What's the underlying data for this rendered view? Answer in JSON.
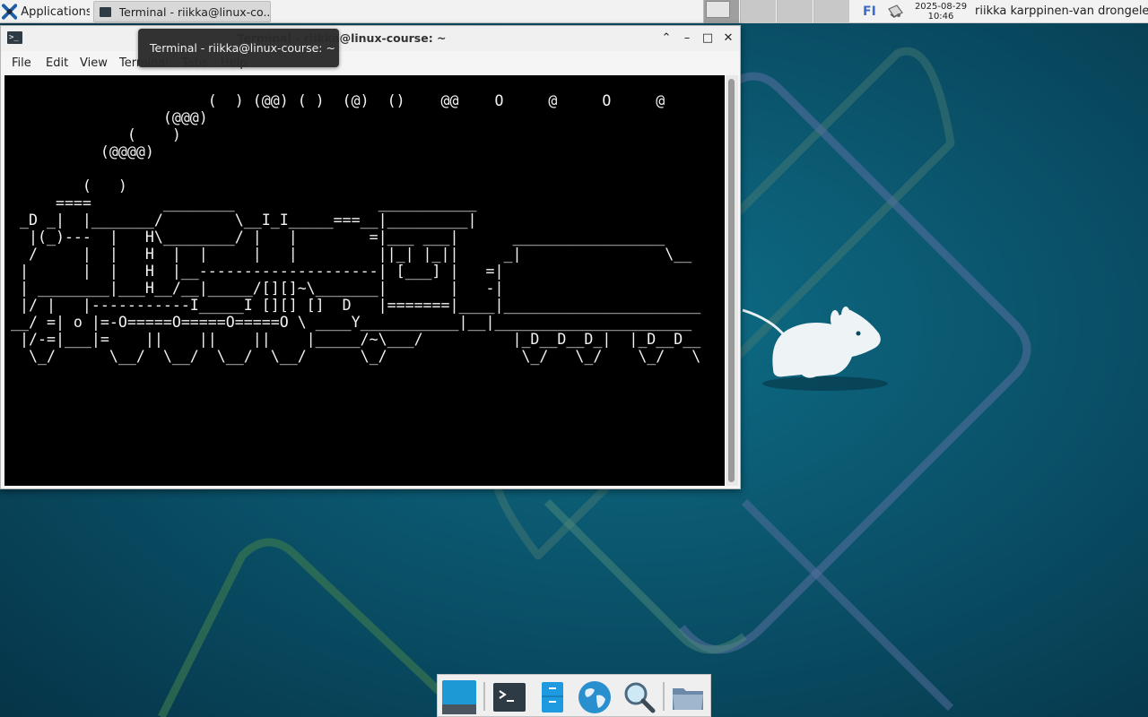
{
  "panel": {
    "applications_label": "Applications",
    "task_title": "Terminal - riikka@linux-co...",
    "keyboard_layout": "FI",
    "clock_date": "2025-08-29",
    "clock_time": "10:46",
    "user_name": "riikka karppinen-van drongelen"
  },
  "window": {
    "title": "Terminal - riikka@linux-course: ~",
    "menu": [
      "File",
      "Edit",
      "View",
      "Terminal",
      "Tabs",
      "Help"
    ],
    "terminal_output": "                      (  ) (@@) ( )  (@)  ()    @@    O     @     O     @\n                 (@@@)\n             (    )\n          (@@@@)\n\n        (   )\n     ====        ________                ___________\n _D _|  |_______/        \\__I_I_____===__|_________|\n  |(_)---  |   H\\________/ |   |        =|___ ___|      _________________\n  /     |  |   H  |  |     |   |         ||_| |_||     _|                \\__\n |      |  |   H  |__--------------------| [___] |   =|\n | ________|___H__/__|_____/[][]~\\_______|       |   -|\n |/ |   |-----------I_____I [][] []  D   |=======|____|______________________\n__/ =| o |=-O=====O=====O=====O \\ ____Y___________|__|______________________\n |/-=|___|=    ||    ||    ||    |_____/~\\___/          |_D__D__D_|  |_D__D__\n  \\_/      \\__/  \\__/  \\__/  \\__/      \\_/               \\_/   \\_/    \\_/   \\"
  },
  "tooltip": {
    "text": "Terminal - riikka@linux-course: ~"
  },
  "dock": {
    "items": [
      "show-desktop",
      "terminal",
      "file-manager",
      "web-browser",
      "app-finder",
      "folder"
    ]
  },
  "colors": {
    "desktop_bg": "#0b5a72",
    "panel_bg": "#f2f2f2",
    "terminal_bg": "#000000",
    "terminal_fg": "#f2f2f2",
    "keyboard_layout_color": "#3b6dc8"
  }
}
